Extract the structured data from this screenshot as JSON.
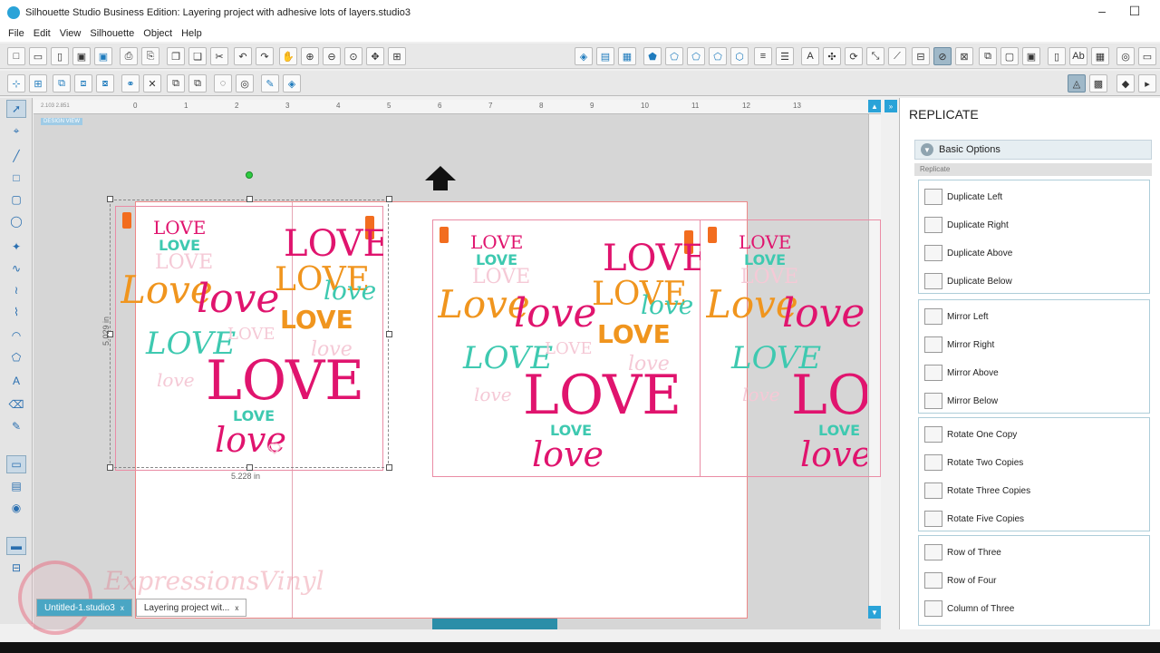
{
  "window": {
    "title": "Silhouette Studio Business Edition: Layering project with adhesive lots of layers.studio3",
    "minimize": "–",
    "maximize": "☐"
  },
  "menu": {
    "items": [
      "File",
      "Edit",
      "View",
      "Silhouette",
      "Object",
      "Help"
    ]
  },
  "canvas": {
    "coords": "2.103  2.851",
    "badge": "DESIGN VIEW",
    "ruler_ticks": [
      "0",
      "1",
      "2",
      "3",
      "4",
      "5",
      "6",
      "7",
      "8",
      "9",
      "10",
      "11",
      "12",
      "13"
    ],
    "height_dim": "5.029 in",
    "width_dim": "5.228 in"
  },
  "panel": {
    "title": "REPLICATE",
    "section": "Basic Options",
    "subsection": "Replicate",
    "groups": [
      {
        "items": [
          "Duplicate Left",
          "Duplicate Right",
          "Duplicate Above",
          "Duplicate Below"
        ]
      },
      {
        "items": [
          "Mirror Left",
          "Mirror Right",
          "Mirror Above",
          "Mirror Below"
        ]
      },
      {
        "items": [
          "Rotate One Copy",
          "Rotate Two Copies",
          "Rotate Three Copies",
          "Rotate Five Copies"
        ]
      },
      {
        "items": [
          "Row of Three",
          "Row of Four",
          "Column of Three"
        ]
      }
    ]
  },
  "tabs": [
    {
      "label": "Untitled-1.studio3",
      "close": "x"
    },
    {
      "label": "Layering project wit...",
      "close": "x"
    }
  ],
  "watermark": {
    "text": "ExpressionsVinyl"
  },
  "colors": {
    "accent": "#2aa3d8",
    "pink": "#e0146e",
    "orange": "#f0951e",
    "teal": "#3ec9b0"
  }
}
